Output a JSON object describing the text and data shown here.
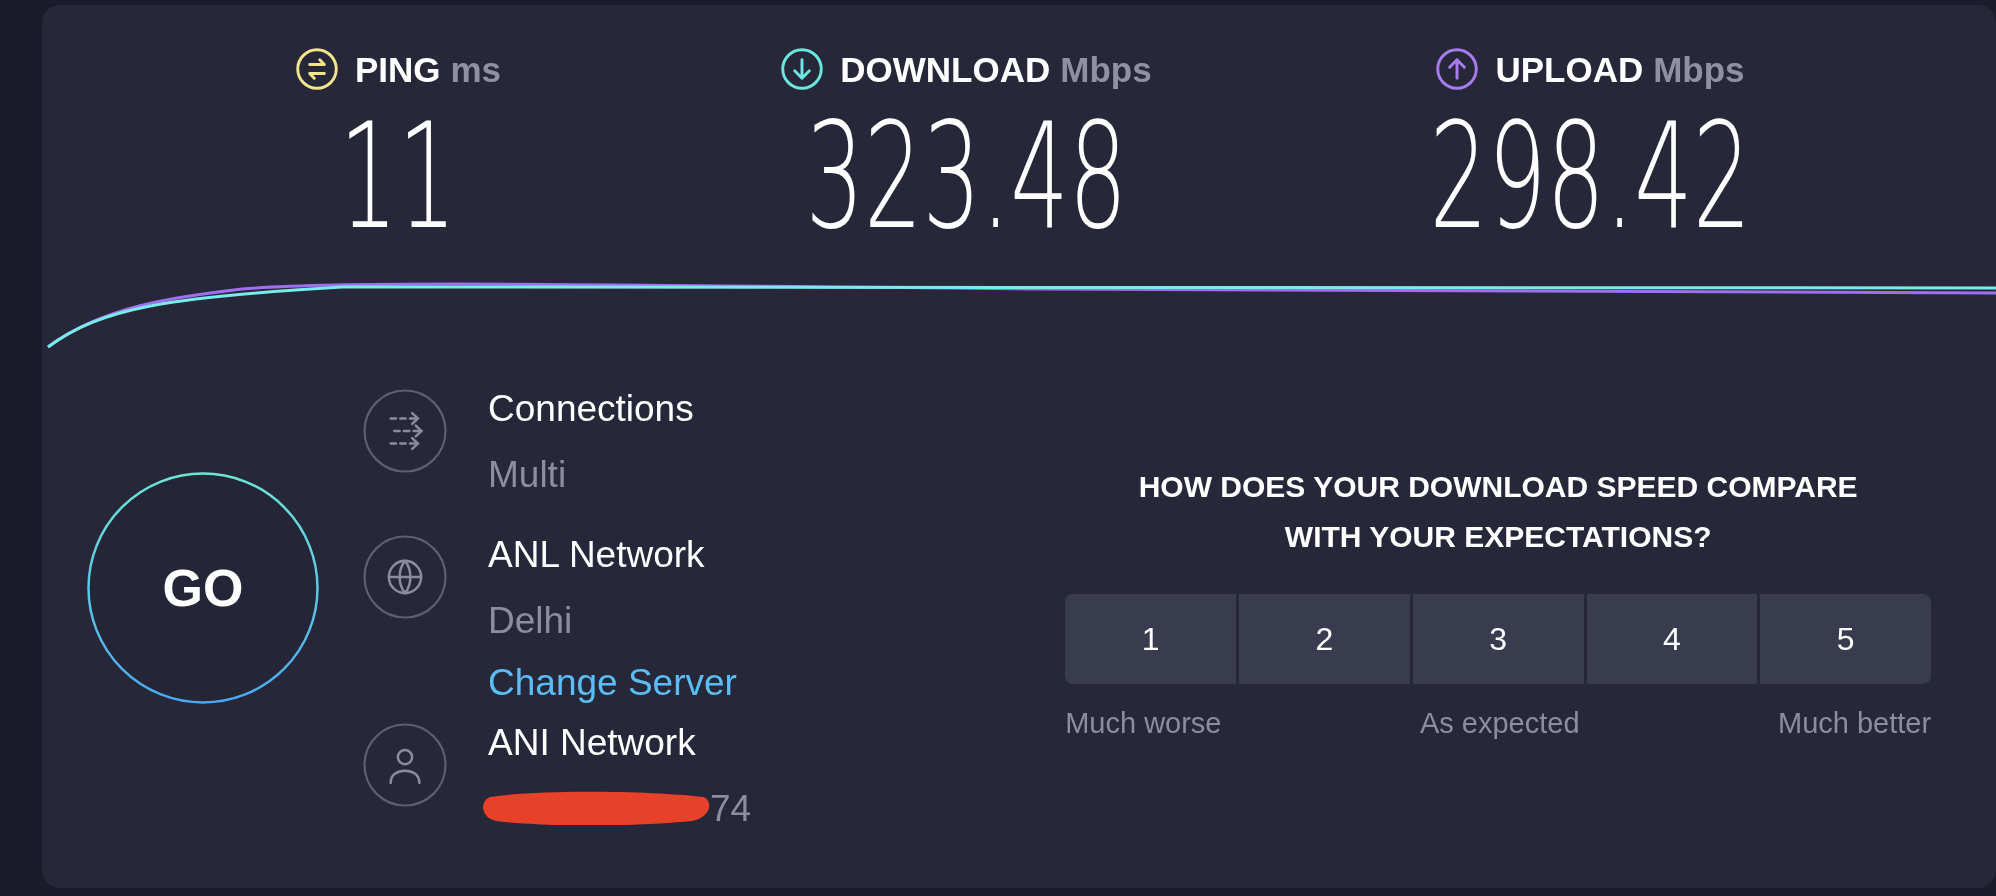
{
  "metrics": [
    {
      "kind": "ping",
      "label": "PING",
      "unit": "ms",
      "value": "11",
      "color": "#f2e58a"
    },
    {
      "kind": "download",
      "label": "DOWNLOAD",
      "unit": "Mbps",
      "value": "323.48",
      "color": "#6ee6e0"
    },
    {
      "kind": "upload",
      "label": "UPLOAD",
      "unit": "Mbps",
      "value": "298.42",
      "color": "#a77cf0"
    }
  ],
  "go_button": {
    "label": "GO"
  },
  "info": [
    {
      "kind": "connections",
      "title": "Connections",
      "subtitle": "Multi"
    },
    {
      "kind": "server",
      "title": "ANL Network",
      "subtitle": "Delhi",
      "link": "Change Server"
    },
    {
      "kind": "provider",
      "title": "ANI Network",
      "subtitle": "74",
      "redacted": true
    }
  ],
  "survey": {
    "question": "HOW DOES YOUR DOWNLOAD SPEED COMPARE WITH YOUR EXPECTATIONS?",
    "options": [
      "1",
      "2",
      "3",
      "4",
      "5"
    ],
    "scale_labels": [
      "Much worse",
      "As expected",
      "Much better"
    ]
  }
}
